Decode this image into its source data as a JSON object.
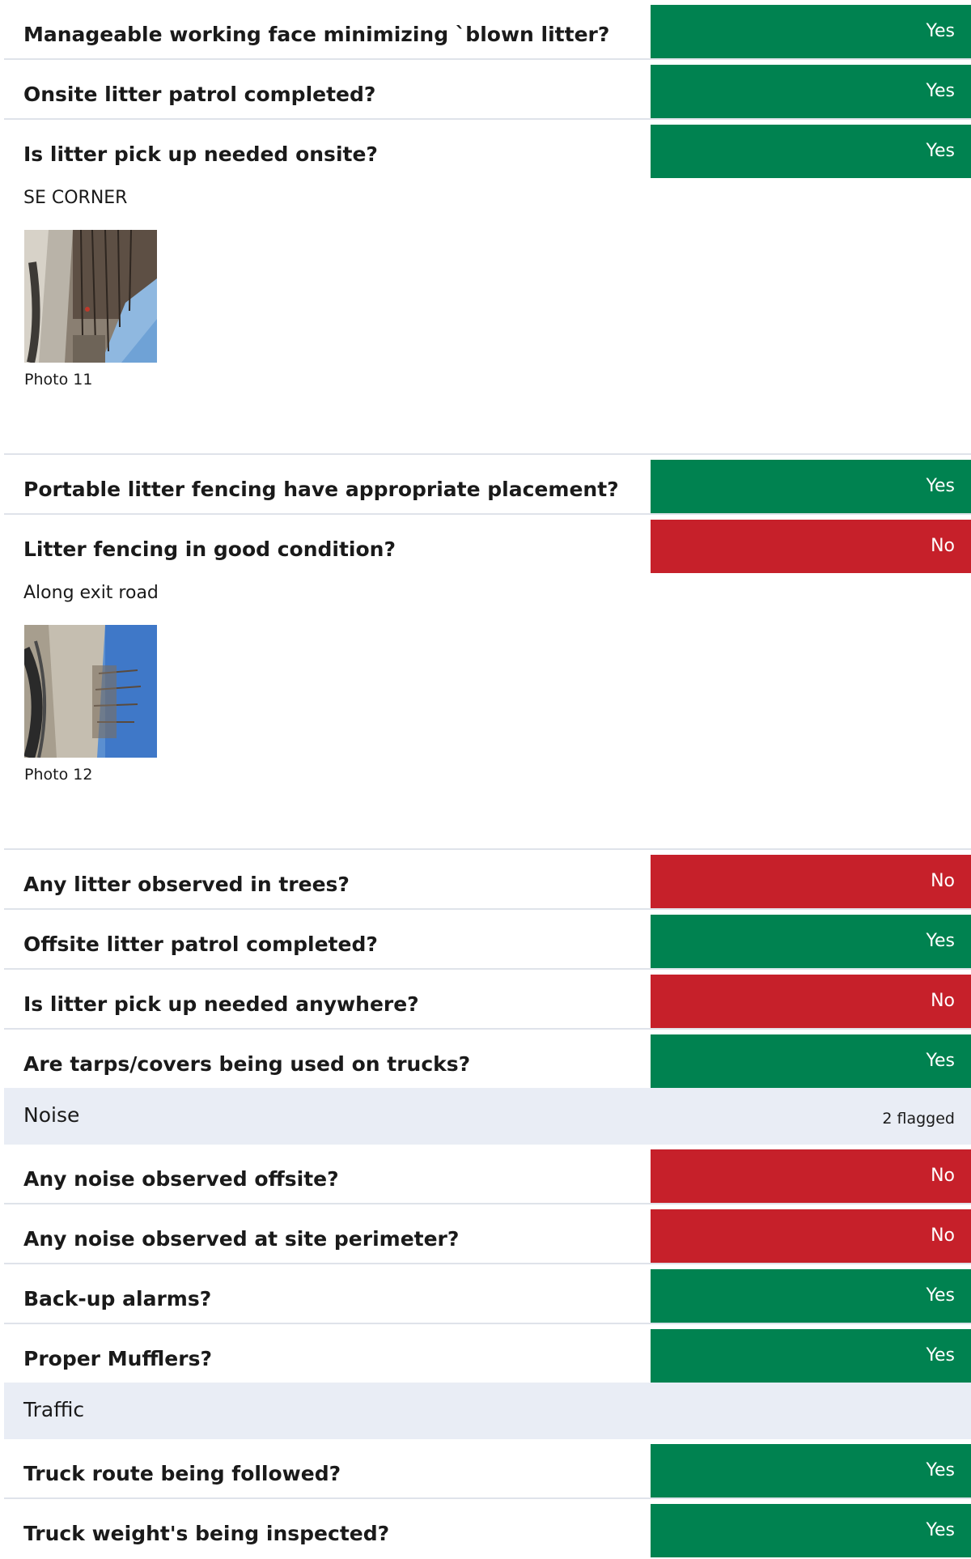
{
  "colors": {
    "yes": "#008250",
    "no": "#c6202a",
    "section_bg": "#e9edf5",
    "divider": "#dfe3ea"
  },
  "items": [
    {
      "question": "Manageable working face minimizing `blown litter?",
      "answer": "Yes"
    },
    {
      "question": "Onsite litter patrol completed?",
      "answer": "Yes"
    },
    {
      "question": "Is litter pick up needed onsite?",
      "answer": "Yes",
      "note": "SE CORNER",
      "photo_caption": "Photo 11"
    },
    {
      "question": "Portable litter fencing have appropriate placement?",
      "answer": "Yes"
    },
    {
      "question": "Litter fencing in good condition?",
      "answer": "No",
      "note": "Along exit road",
      "photo_caption": "Photo 12"
    },
    {
      "question": "Any litter observed in trees?",
      "answer": "No"
    },
    {
      "question": "Offsite litter patrol completed?",
      "answer": "Yes"
    },
    {
      "question": "Is litter pick up needed anywhere?",
      "answer": "No"
    },
    {
      "question": "Are tarps/covers being used on trucks?",
      "answer": "Yes"
    }
  ],
  "noise_section": {
    "title": "Noise",
    "flag_text": "2 flagged",
    "items": [
      {
        "question": "Any noise observed offsite?",
        "answer": "No"
      },
      {
        "question": "Any noise observed at site perimeter?",
        "answer": "No"
      },
      {
        "question": "Back-up alarms?",
        "answer": "Yes"
      },
      {
        "question": "Proper Mufflers?",
        "answer": "Yes"
      }
    ]
  },
  "traffic_section": {
    "title": "Traffic",
    "items": [
      {
        "question": "Truck route being followed?",
        "answer": "Yes"
      },
      {
        "question": "Truck weight's being inspected?",
        "answer": "Yes"
      }
    ]
  }
}
